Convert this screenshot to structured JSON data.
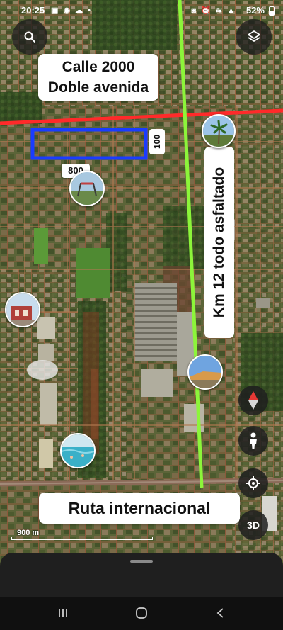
{
  "status_bar": {
    "time": "20:25",
    "notifications": "▣ ◉ ☁ •",
    "system_icons": "◙ ⏰ ≋ ▲",
    "battery": "52%"
  },
  "map": {
    "type": "satellite",
    "annotations": {
      "street": [
        "Calle 2000",
        "Doble avenida"
      ],
      "highway": "Km 12 todo asfaltado",
      "route": "Ruta internacional",
      "width_label": "100",
      "length_label": "800"
    },
    "colors": {
      "street_line": "#ff2a2a",
      "highway_line": "#8cf53a",
      "plot_outline": "#1a3cff"
    },
    "scale": "900 m",
    "controls": {
      "view_3d": "3D"
    }
  }
}
